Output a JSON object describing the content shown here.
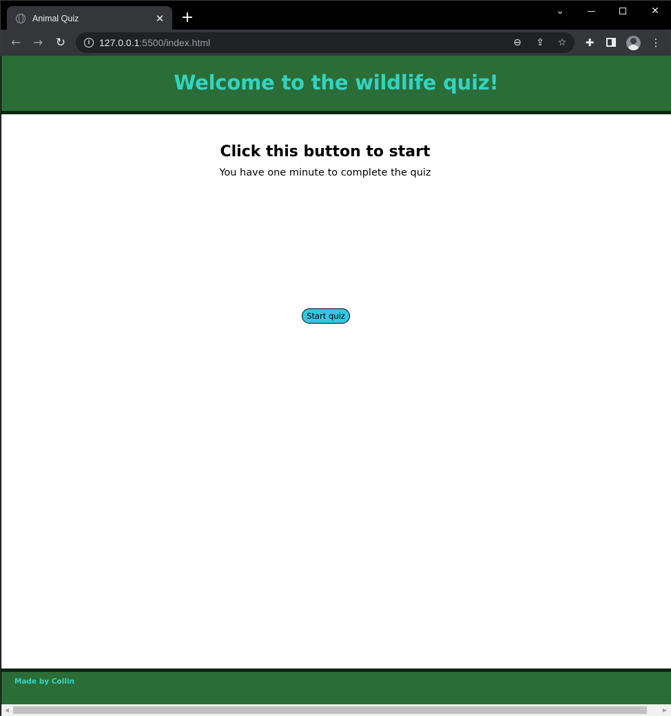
{
  "browser": {
    "tab": {
      "title": "Animal Quiz",
      "close_glyph": "✕",
      "favicon": "globe-icon"
    },
    "new_tab_glyph": "+",
    "window_controls": {
      "tabsearch_glyph": "⌄",
      "close_glyph": "✕"
    },
    "nav": {
      "back_glyph": "←",
      "forward_glyph": "→",
      "reload_glyph": "↻"
    },
    "address": {
      "host": "127.0.0.1",
      "rest": ":5500/index.html"
    },
    "toolbar_icons": {
      "zoom_glyph": "⊖",
      "share_glyph": "⇪",
      "bookmark_glyph": "☆",
      "extensions_glyph": "✚",
      "menu_glyph": "⋮"
    }
  },
  "page": {
    "header_title": "Welcome to the wildlife quiz!",
    "heading": "Click this button to start",
    "subheading": "You have one minute to complete the quiz",
    "start_button": "Start quiz",
    "footer_text": "Made by Collin"
  },
  "scrollbar": {
    "left_arrow": "◀",
    "right_arrow": "▶"
  },
  "colors": {
    "header_bg": "#2b6d37",
    "header_border": "#0d2612",
    "accent_text": "#32d4c4",
    "button_bg": "#35c7e2"
  }
}
